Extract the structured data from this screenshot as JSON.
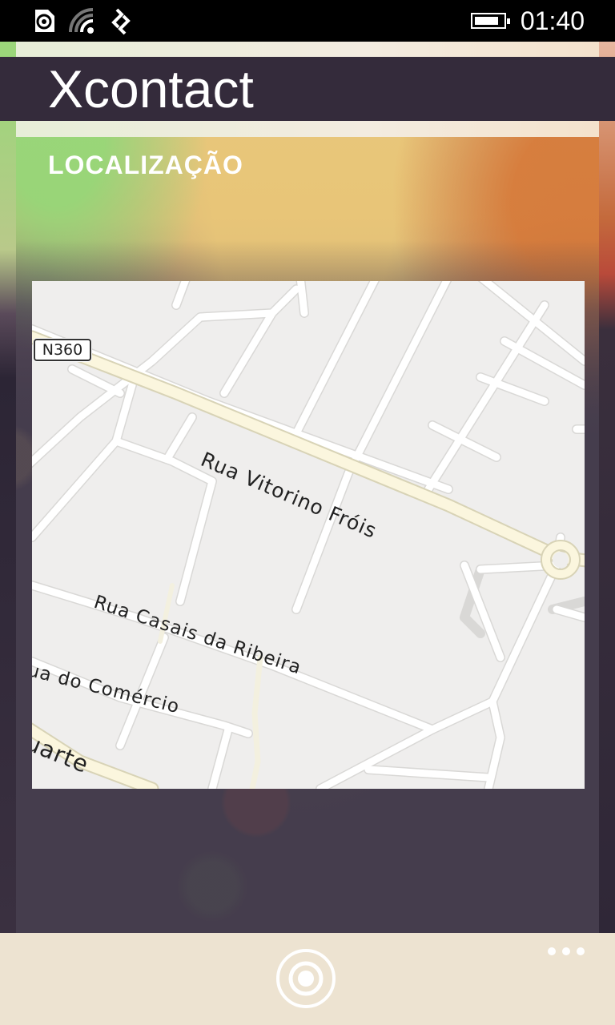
{
  "status_bar": {
    "time": "01:40",
    "battery_level": 0.85,
    "icons": [
      "notification-icon",
      "wifi-icon",
      "data-connection-icon",
      "battery-icon"
    ]
  },
  "app": {
    "title": "Xcontact"
  },
  "section": {
    "title": "LOCALIZAÇÃO"
  },
  "map": {
    "road_shield": "N360",
    "labels": {
      "street_1": "Rua Vitorino Fróis",
      "street_2": "Rua Casais da Ribeira",
      "street_3": "ua do Comércio",
      "street_4": "Duarte"
    }
  },
  "app_bar": {
    "primary_button_icon": "locate-me-icon",
    "more_icon": "ellipsis-icon"
  },
  "colors": {
    "title_bar": "#342b3b",
    "app_bar": "#ede3d1",
    "map_background": "#efeeed",
    "map_major_road": "#fbf6de",
    "map_minor_road": "#ffffff"
  }
}
